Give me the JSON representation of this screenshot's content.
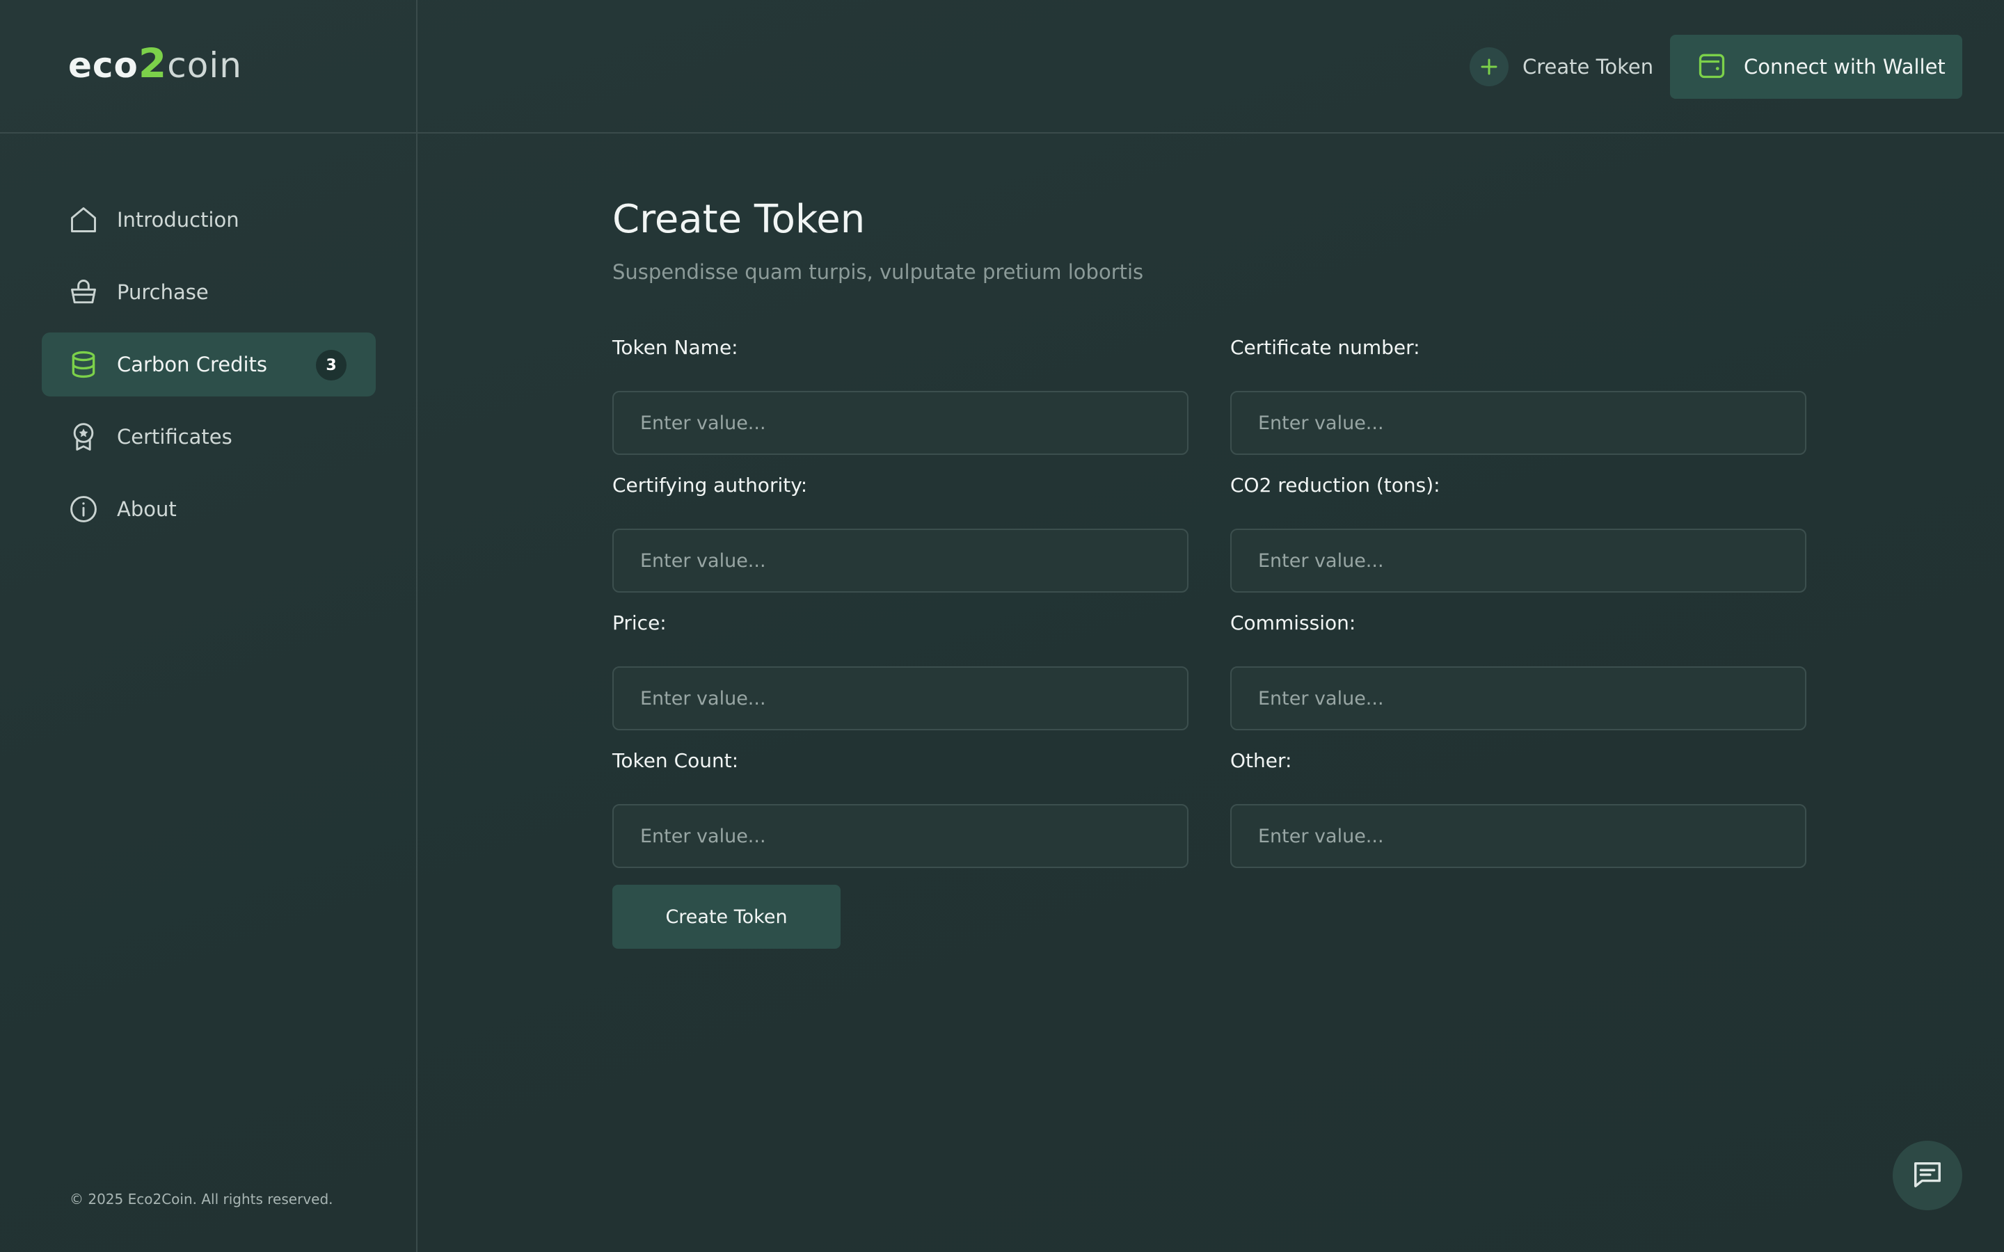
{
  "brand": {
    "part1": "eco",
    "part2": "2",
    "part3": "coin"
  },
  "header": {
    "create_token_label": "Create Token",
    "connect_wallet_label": "Connect with Wallet"
  },
  "sidebar": {
    "items": [
      {
        "label": "Introduction",
        "icon": "home-icon"
      },
      {
        "label": "Purchase",
        "icon": "basket-icon"
      },
      {
        "label": "Carbon Credits",
        "icon": "database-icon",
        "badge": "3",
        "active": true
      },
      {
        "label": "Certificates",
        "icon": "award-icon"
      },
      {
        "label": "About",
        "icon": "info-icon"
      }
    ],
    "copyright": "© 2025 Eco2Coin. All rights reserved."
  },
  "main": {
    "title": "Create Token",
    "subtitle": "Suspendisse quam turpis, vulputate pretium lobortis",
    "fields": [
      {
        "label": "Token Name:",
        "placeholder": "Enter value...",
        "value": ""
      },
      {
        "label": "Certificate number:",
        "placeholder": "Enter value...",
        "value": ""
      },
      {
        "label": "Certifying authority:",
        "placeholder": "Enter value...",
        "value": ""
      },
      {
        "label": "CO2 reduction (tons):",
        "placeholder": "Enter value...",
        "value": ""
      },
      {
        "label": "Price:",
        "placeholder": "Enter value...",
        "value": ""
      },
      {
        "label": "Commission:",
        "placeholder": "Enter value...",
        "value": ""
      },
      {
        "label": "Token Count:",
        "placeholder": "Enter value...",
        "value": ""
      },
      {
        "label": "Other:",
        "placeholder": "Enter value...",
        "value": ""
      }
    ],
    "submit_label": "Create Token"
  },
  "colors": {
    "accent_green": "#7cd14a",
    "background": "#253636",
    "active_item": "#2d4f4a",
    "button": "#2d514b"
  },
  "chat": {
    "icon": "chat-icon"
  }
}
